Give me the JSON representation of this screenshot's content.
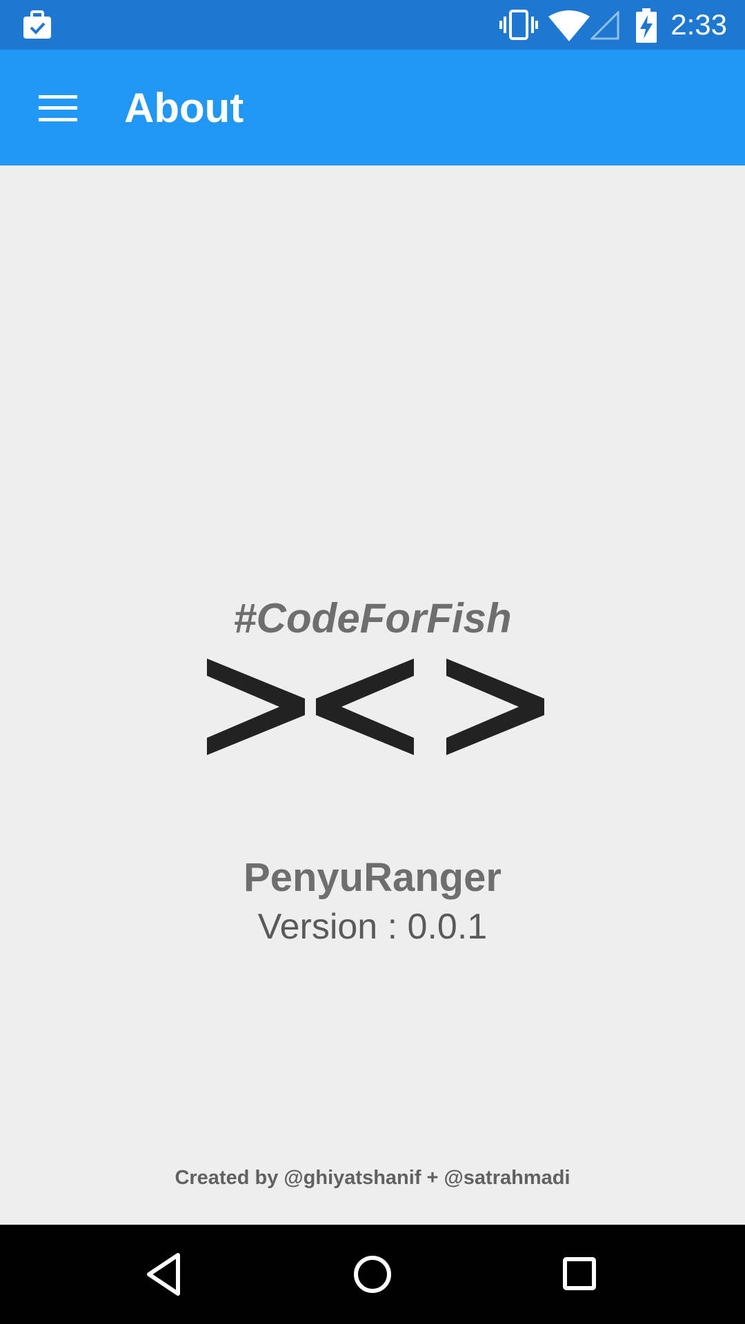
{
  "status_bar": {
    "time": "2:33",
    "icons": [
      "work-briefcase-icon",
      "vibrate-icon",
      "wifi-icon",
      "signal-icon",
      "battery-charging-icon"
    ]
  },
  "app_bar": {
    "title": "About",
    "menu_icon": "hamburger-menu-icon",
    "background": "#2196f3"
  },
  "content": {
    "hashtag": "#CodeForFish",
    "logo_icon": "fish-symbol-icon",
    "app_name": "PenyuRanger",
    "version": "Version : 0.0.1",
    "credits": "Created by @ghiyatshanif + @satrahmadi"
  },
  "nav_bar": {
    "buttons": [
      "back-icon",
      "home-icon",
      "recents-icon"
    ]
  }
}
